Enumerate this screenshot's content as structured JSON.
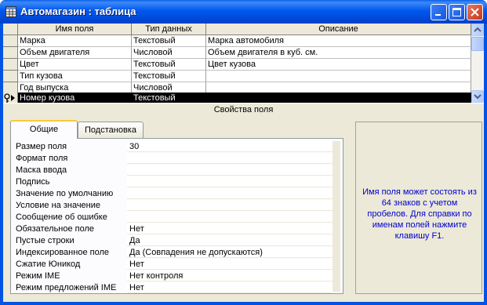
{
  "window": {
    "title": "Автомагазин : таблица",
    "accent": "#0054e3"
  },
  "grid": {
    "headers": [
      "Имя поля",
      "Тип данных",
      "Описание"
    ],
    "rows": [
      {
        "name": "Марка",
        "type": "Текстовый",
        "desc": "Марка автомобиля"
      },
      {
        "name": "Объем двигателя",
        "type": "Числовой",
        "desc": "Объем двигателя в куб. см."
      },
      {
        "name": "Цвет",
        "type": "Текстовый",
        "desc": "Цвет кузова"
      },
      {
        "name": "Тип кузова",
        "type": "Текстовый",
        "desc": ""
      },
      {
        "name": "Год выпуска",
        "type": "Числовой",
        "desc": ""
      },
      {
        "name": "Номер кузова",
        "type": "Текстовый",
        "desc": ""
      }
    ],
    "current_row_index": 5,
    "key_row_icons": [
      "key-icon",
      "row-pointer-icon"
    ]
  },
  "field_properties": {
    "section_title": "Свойства поля",
    "tabs": [
      "Общие",
      "Подстановка"
    ],
    "active_tab": "Общие",
    "rows": [
      {
        "label": "Размер поля",
        "value": "30"
      },
      {
        "label": "Формат поля",
        "value": ""
      },
      {
        "label": "Маска ввода",
        "value": ""
      },
      {
        "label": "Подпись",
        "value": ""
      },
      {
        "label": "Значение по умолчанию",
        "value": ""
      },
      {
        "label": "Условие на значение",
        "value": ""
      },
      {
        "label": "Сообщение об ошибке",
        "value": ""
      },
      {
        "label": "Обязательное поле",
        "value": "Нет"
      },
      {
        "label": "Пустые строки",
        "value": "Да"
      },
      {
        "label": "Индексированное поле",
        "value": "Да (Совпадения не допускаются)"
      },
      {
        "label": "Сжатие Юникод",
        "value": "Нет"
      },
      {
        "label": "Режим IME",
        "value": "Нет контроля"
      },
      {
        "label": "Режим предложений IME",
        "value": "Нет"
      }
    ]
  },
  "help": {
    "text": "Имя поля может состоять из 64 знаков с учетом пробелов.  Для справки по именам полей нажмите клавишу F1.",
    "color": "#0000cc"
  }
}
